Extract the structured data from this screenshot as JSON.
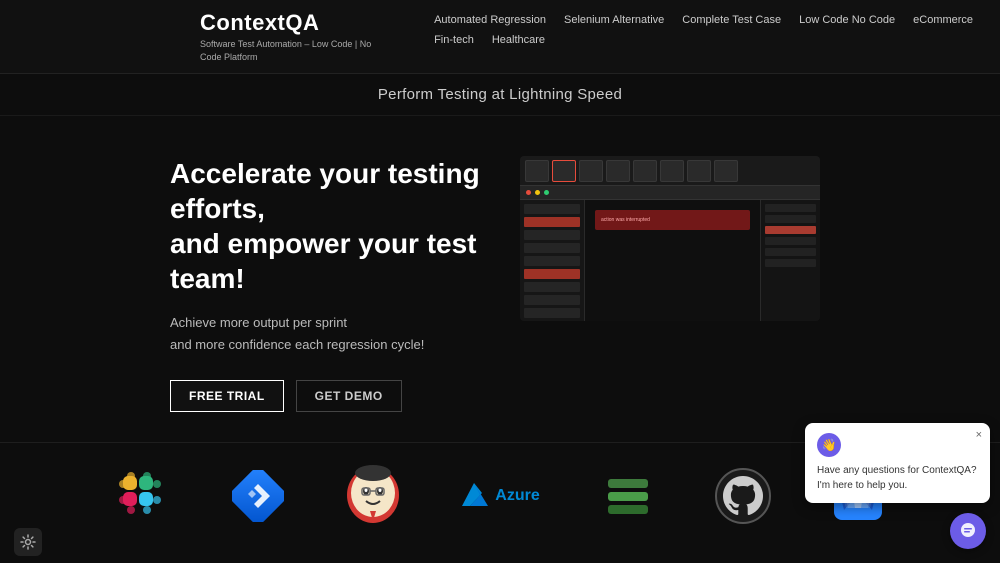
{
  "brand": {
    "name": "ContextQA",
    "tagline": "Software Test Automation – Low Code | No Code\nPlatform"
  },
  "nav": {
    "items": [
      {
        "label": "Automated Regression",
        "row": 1
      },
      {
        "label": "Selenium Alternative",
        "row": 1
      },
      {
        "label": "Complete Test Case",
        "row": 1
      },
      {
        "label": "Low Code No Code",
        "row": 1
      },
      {
        "label": "eCommerce",
        "row": 1
      },
      {
        "label": "Fin-tech",
        "row": 2
      },
      {
        "label": "Healthcare",
        "row": 2
      }
    ]
  },
  "hero": {
    "subtitle": "Perform Testing at Lightning Speed"
  },
  "main": {
    "headline": "Accelerate your testing efforts,\nand empower your test team!",
    "subtext_line1": "Achieve more output per sprint",
    "subtext_line2": "and more confidence each regression cycle!",
    "cta_primary": "FREE TRIAL",
    "cta_secondary": "GET DEMO"
  },
  "integrations": {
    "logos": [
      {
        "name": "Slack",
        "type": "slack"
      },
      {
        "name": "Jira",
        "type": "jira"
      },
      {
        "name": "Jenkins",
        "type": "jenkins"
      },
      {
        "name": "Azure",
        "type": "azure"
      },
      {
        "name": "Stackify",
        "type": "stackify"
      },
      {
        "name": "GitHub",
        "type": "github"
      },
      {
        "name": "Bitbucket",
        "type": "bitbucket"
      }
    ]
  },
  "chat": {
    "avatar_emoji": "👋",
    "message": "Have any questions for ContextQA? I'm here to help you.",
    "close_label": "×"
  },
  "icons": {
    "settings": "⚙",
    "chat_bubble": "💬"
  }
}
